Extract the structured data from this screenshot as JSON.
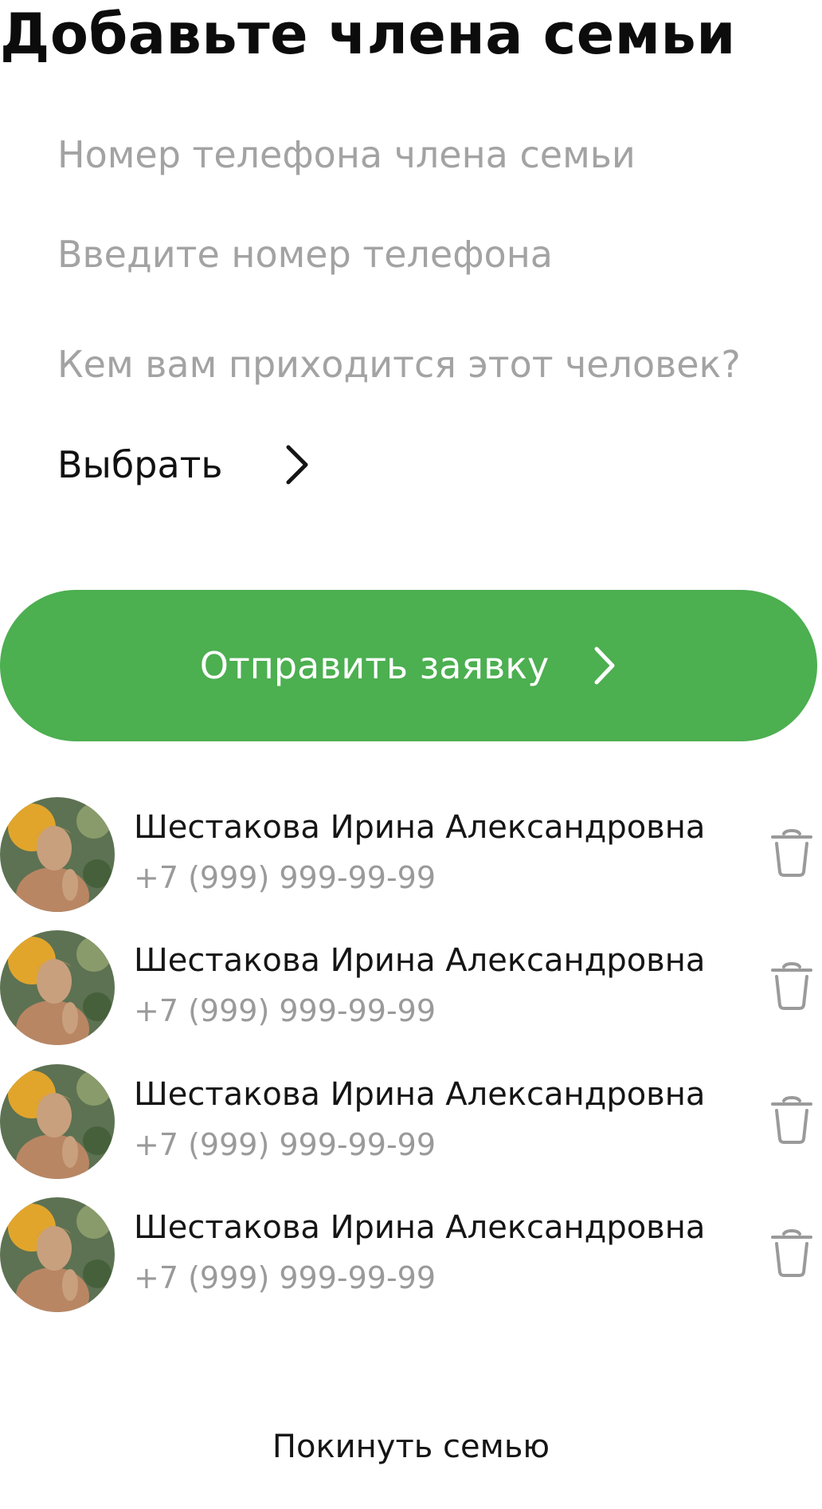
{
  "header": {
    "title": "Добавьте члена семьи"
  },
  "form": {
    "phone_label": "Номер телефона члена семьи",
    "phone_placeholder": "Введите номер телефона",
    "phone_value": "",
    "relation_label": "Кем вам приходится этот человек?",
    "relation_select_label": "Выбрать",
    "submit_label": "Отправить заявку"
  },
  "colors": {
    "accent": "#4caf50",
    "text_primary": "#151515",
    "text_muted": "#a3a3a3",
    "icon_gray": "#9a9a9a"
  },
  "members": [
    {
      "name": "Шестакова Ирина Александровна",
      "phone": "+7 (999) 999-99-99",
      "avatar_icon": "avatar-photo",
      "action_icon": "trash-icon"
    },
    {
      "name": "Шестакова Ирина Александровна",
      "phone": "+7 (999) 999-99-99",
      "avatar_icon": "avatar-photo",
      "action_icon": "trash-icon"
    },
    {
      "name": "Шестакова Ирина Александровна",
      "phone": "+7 (999) 999-99-99",
      "avatar_icon": "avatar-photo",
      "action_icon": "trash-icon"
    },
    {
      "name": "Шестакова Ирина Александровна",
      "phone": "+7 (999) 999-99-99",
      "avatar_icon": "avatar-photo",
      "action_icon": "trash-icon"
    }
  ],
  "footer": {
    "leave_label": "Покинуть  семью"
  }
}
